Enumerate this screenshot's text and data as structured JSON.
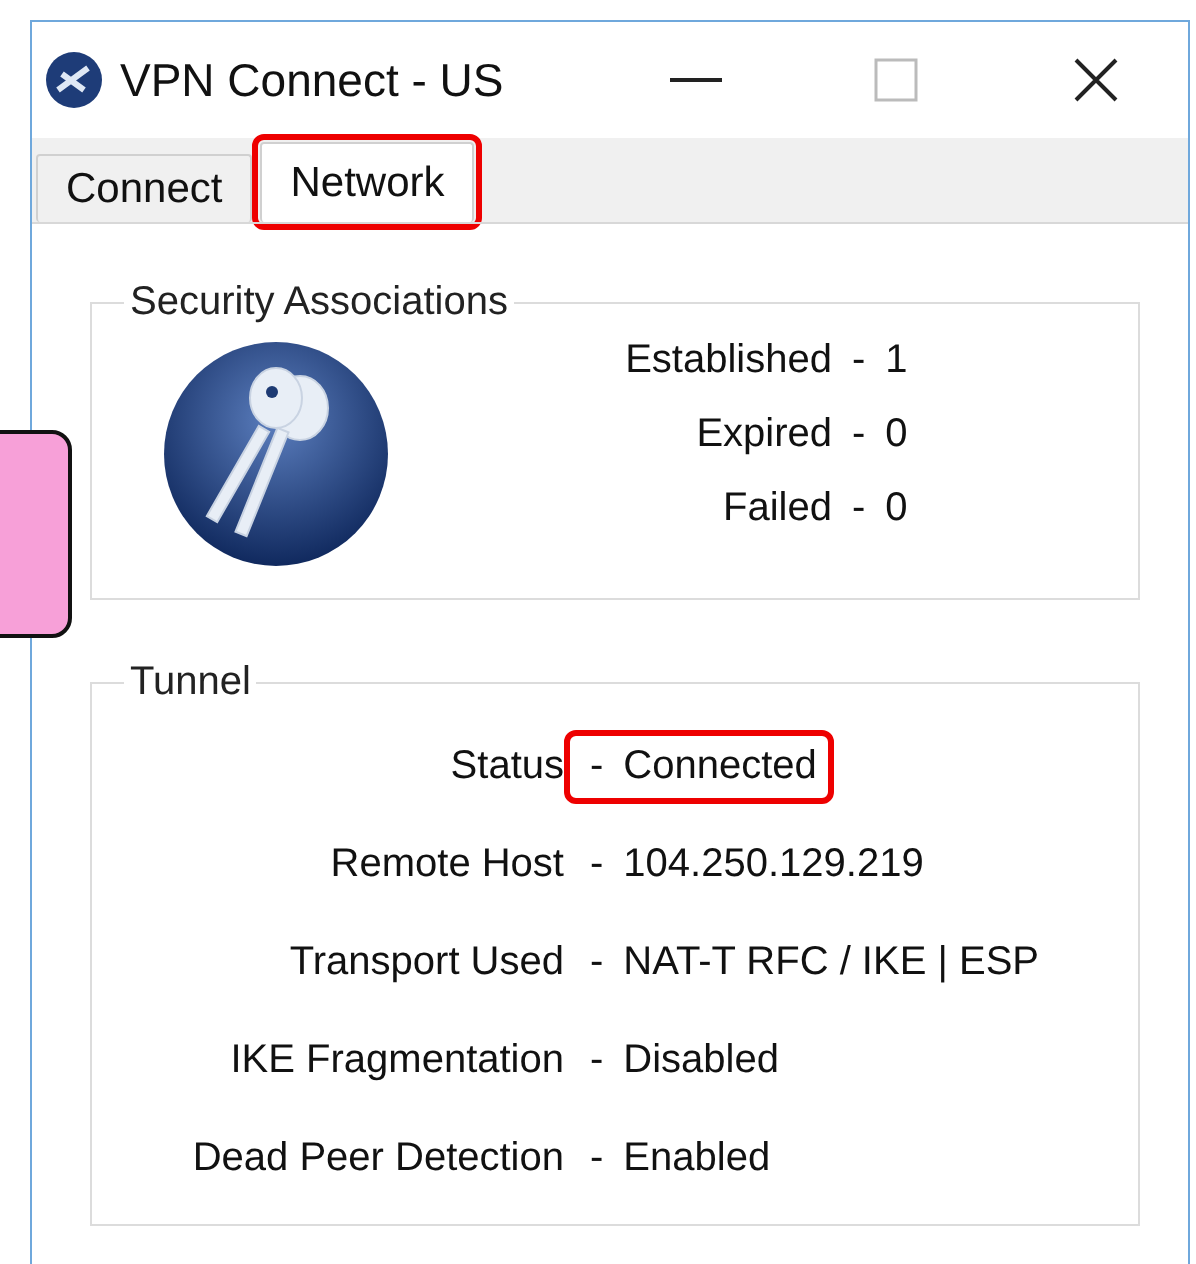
{
  "window": {
    "title": "VPN Connect - US"
  },
  "tabs": [
    {
      "label": "Connect",
      "selected": false,
      "highlighted": false
    },
    {
      "label": "Network",
      "selected": true,
      "highlighted": true
    }
  ],
  "security_associations": {
    "title": "Security Associations",
    "rows": [
      {
        "label": "Established",
        "value": "1"
      },
      {
        "label": "Expired",
        "value": "0"
      },
      {
        "label": "Failed",
        "value": "0"
      }
    ]
  },
  "tunnel": {
    "title": "Tunnel",
    "rows": [
      {
        "label": "Status",
        "value": "Connected",
        "highlighted": true
      },
      {
        "label": "Remote Host",
        "value": "104.250.129.219",
        "highlighted": false
      },
      {
        "label": "Transport Used",
        "value": "NAT-T RFC / IKE | ESP",
        "highlighted": false
      },
      {
        "label": "IKE Fragmentation",
        "value": "Disabled",
        "highlighted": false
      },
      {
        "label": "Dead Peer Detection",
        "value": "Enabled",
        "highlighted": false
      }
    ]
  },
  "separator": "-"
}
